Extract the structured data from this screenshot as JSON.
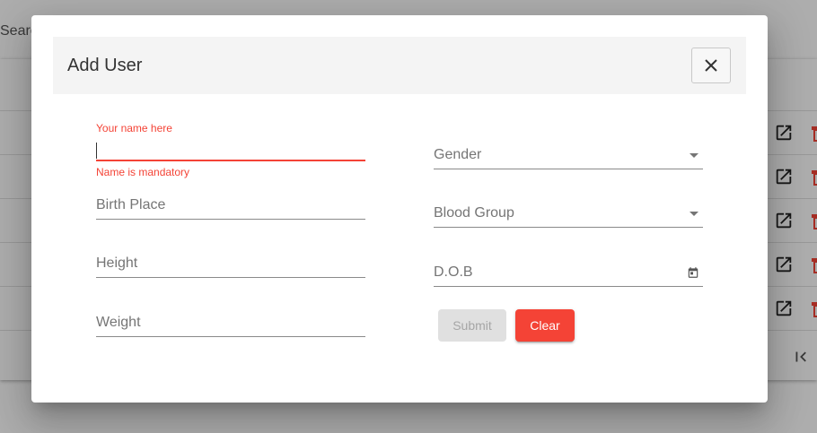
{
  "background": {
    "search_label": "Searc",
    "row_count": 5
  },
  "dialog": {
    "title": "Add User",
    "close_icon": "close-icon"
  },
  "form": {
    "name": {
      "label": "Your name here",
      "value": "",
      "error": "Name is mandatory"
    },
    "gender": {
      "placeholder": "Gender",
      "value": ""
    },
    "birth_place": {
      "placeholder": "Birth Place",
      "value": ""
    },
    "blood_group": {
      "placeholder": "Blood Group",
      "value": ""
    },
    "height": {
      "placeholder": "Height",
      "value": ""
    },
    "dob": {
      "placeholder": "D.O.B",
      "value": "",
      "icon": "calendar-icon"
    },
    "weight": {
      "placeholder": "Weight",
      "value": ""
    }
  },
  "buttons": {
    "submit_label": "Submit",
    "clear_label": "Clear"
  },
  "colors": {
    "error": "#f44336",
    "accent_warn": "#f44336",
    "disabled_bg": "#e0e0e0",
    "header_bg": "#f4f4f4"
  }
}
